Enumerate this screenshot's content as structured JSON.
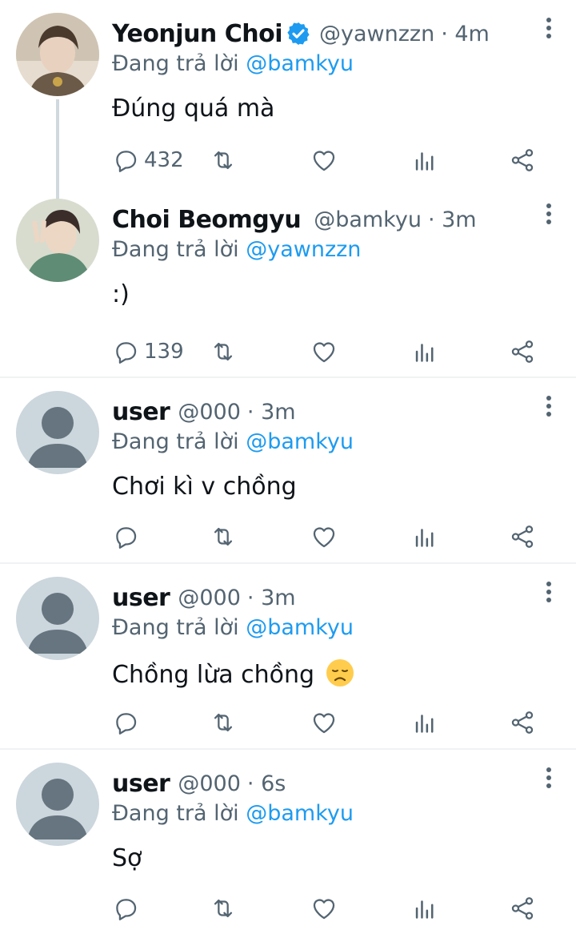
{
  "accent": "#1d9bf0",
  "tweets": [
    {
      "name": "Yeonjun Choi",
      "verified": true,
      "handle": "@yawnzzn",
      "time": "· 4m",
      "replying_prefix": "Đang trả lời",
      "replying_to": "@bamkyu",
      "text": "Đúng quá mà",
      "reply_count": "432",
      "avatar": "profile-photo"
    },
    {
      "name": "Choi Beomgyu",
      "verified": false,
      "handle": "@bamkyu",
      "time": "· 3m",
      "replying_prefix": "Đang trả lời",
      "replying_to": "@yawnzzn",
      "text": ":)",
      "reply_count": "139",
      "avatar": "profile-photo"
    },
    {
      "name": "user",
      "verified": false,
      "handle": "@000",
      "time": "· 3m",
      "replying_prefix": "Đang trả lời",
      "replying_to": "@bamkyu",
      "text": "Chơi kì v chồng",
      "reply_count": "",
      "avatar": "default-avatar"
    },
    {
      "name": "user",
      "verified": false,
      "handle": "@000",
      "time": "· 3m",
      "replying_prefix": "Đang trả lời",
      "replying_to": "@bamkyu",
      "text": "Chồng lừa chồng",
      "emoji": "disappointed-face",
      "reply_count": "",
      "avatar": "default-avatar"
    },
    {
      "name": "user",
      "verified": false,
      "handle": "@000",
      "time": "· 6s",
      "replying_prefix": "Đang trả lời",
      "replying_to": "@bamkyu",
      "text": "Sợ",
      "reply_count": "",
      "avatar": "default-avatar"
    }
  ],
  "icons": [
    "reply-icon",
    "retweet-icon",
    "like-icon",
    "views-icon",
    "share-icon",
    "more-icon",
    "verified-badge-icon"
  ]
}
